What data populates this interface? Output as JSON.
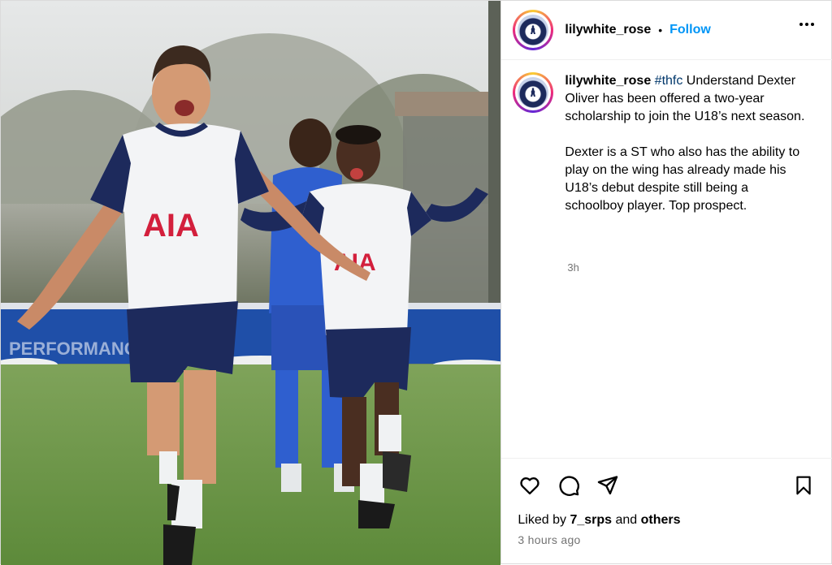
{
  "post": {
    "username": "lilywhite_rose",
    "separator": "•",
    "follow_label": "Follow",
    "more_icon": "more-horizontal-icon"
  },
  "caption": {
    "username": "lilywhite_rose",
    "hashtag": "#thfc",
    "text": " Understand Dexter Oliver has been offered a two-year scholarship to join the U18’s next season.\n\nDexter is a ST who also has the ability to play on the wing has already made his U18’s debut despite still being a schoolboy player. Top prospect.",
    "age": "3h"
  },
  "photo": {
    "shirt_sponsor": "AIA",
    "banner_text": "PERFORMANCE CENTRE"
  },
  "actions": {
    "like_icon": "heart-icon",
    "comment_icon": "comment-icon",
    "share_icon": "send-icon",
    "save_icon": "bookmark-icon"
  },
  "likes": {
    "prefix": "Liked by ",
    "user": "7_srps",
    "connector": " and ",
    "others": "others"
  },
  "timestamp": "3 hours ago",
  "colors": {
    "link_blue": "#0095f6",
    "hashtag": "#00376b",
    "muted": "#737373",
    "spurs_navy": "#1d2a5c",
    "aia_red": "#d31f3c"
  }
}
